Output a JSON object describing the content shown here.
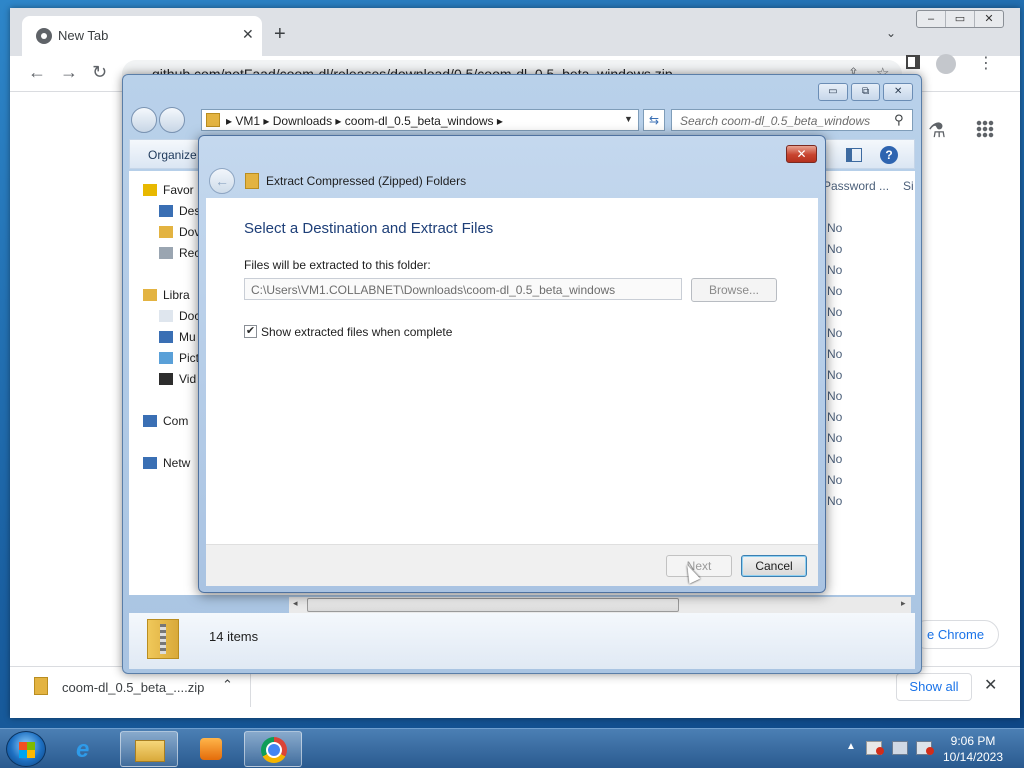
{
  "chrome": {
    "tab_title": "New Tab",
    "tab_close": "✕",
    "new_tab": "+",
    "tab_search": "⌄",
    "window_controls": [
      "–",
      "▭",
      "✕"
    ],
    "nav": {
      "back": "←",
      "forward": "→",
      "reload": "↻"
    },
    "url": "github.com/notFaad/coom-dl/releases/download/0.5/coom-dl_0.5_beta_windows.zip",
    "share": "⇪",
    "star": "☆",
    "menu": "⋮",
    "labs": "⚗",
    "customize_label": "e Chrome"
  },
  "download_bar": {
    "file_name": "coom-dl_0.5_beta_....zip",
    "chevron": "⌃",
    "show_all": "Show all",
    "close": "✕"
  },
  "explorer": {
    "window_controls": [
      "▭",
      "⧉",
      "✕"
    ],
    "breadcrumbs": "▸  VM1  ▸  Downloads  ▸  coom-dl_0.5_beta_windows  ▸",
    "dropdown": "▼",
    "refresh": "⇆",
    "search_placeholder": "Search coom-dl_0.5_beta_windows",
    "search_icon": "⚲",
    "organize": "Organize",
    "help": "?",
    "nav_items": [
      {
        "label": "Favor",
        "color": "#e8b800"
      },
      {
        "label": "Des",
        "color": "#3a6fb4"
      },
      {
        "label": "Dov",
        "color": "#e3b341"
      },
      {
        "label": "Rec",
        "color": "#9aa5b1"
      },
      {
        "label": "Libra",
        "color": "#e3b341"
      },
      {
        "label": "Doc",
        "color": "#dfe6ee"
      },
      {
        "label": "Mu",
        "color": "#3a6fb4"
      },
      {
        "label": "Pict",
        "color": "#5aa0d8"
      },
      {
        "label": "Vid",
        "color": "#2d2d2d"
      },
      {
        "label": "Com",
        "color": "#3a6fb4"
      },
      {
        "label": "Netw",
        "color": "#3a6fb4"
      }
    ],
    "columns": {
      "password": "Password ...",
      "size": "Si"
    },
    "password_values": [
      "No",
      "No",
      "No",
      "No",
      "No",
      "No",
      "No",
      "No",
      "No",
      "No",
      "No",
      "No",
      "No",
      "No"
    ],
    "scroll": {
      "left": "◂",
      "right": "▸",
      "grip": "⦀"
    },
    "status_count": "14 items"
  },
  "dialog": {
    "close": "✕",
    "back": "←",
    "title": "Extract Compressed (Zipped) Folders",
    "heading": "Select a Destination and Extract Files",
    "folder_label": "Files will be extracted to this folder:",
    "path": "C:\\Users\\VM1.COLLABNET\\Downloads\\coom-dl_0.5_beta_windows",
    "browse": "Browse...",
    "show_files_checked": true,
    "check_mark": "✔",
    "show_files_label": "Show extracted files when complete",
    "next": "Next",
    "cancel": "Cancel"
  },
  "taskbar": {
    "ie_glyph": "e",
    "tray_up": "▲",
    "time": "9:06 PM",
    "date": "10/14/2023"
  }
}
